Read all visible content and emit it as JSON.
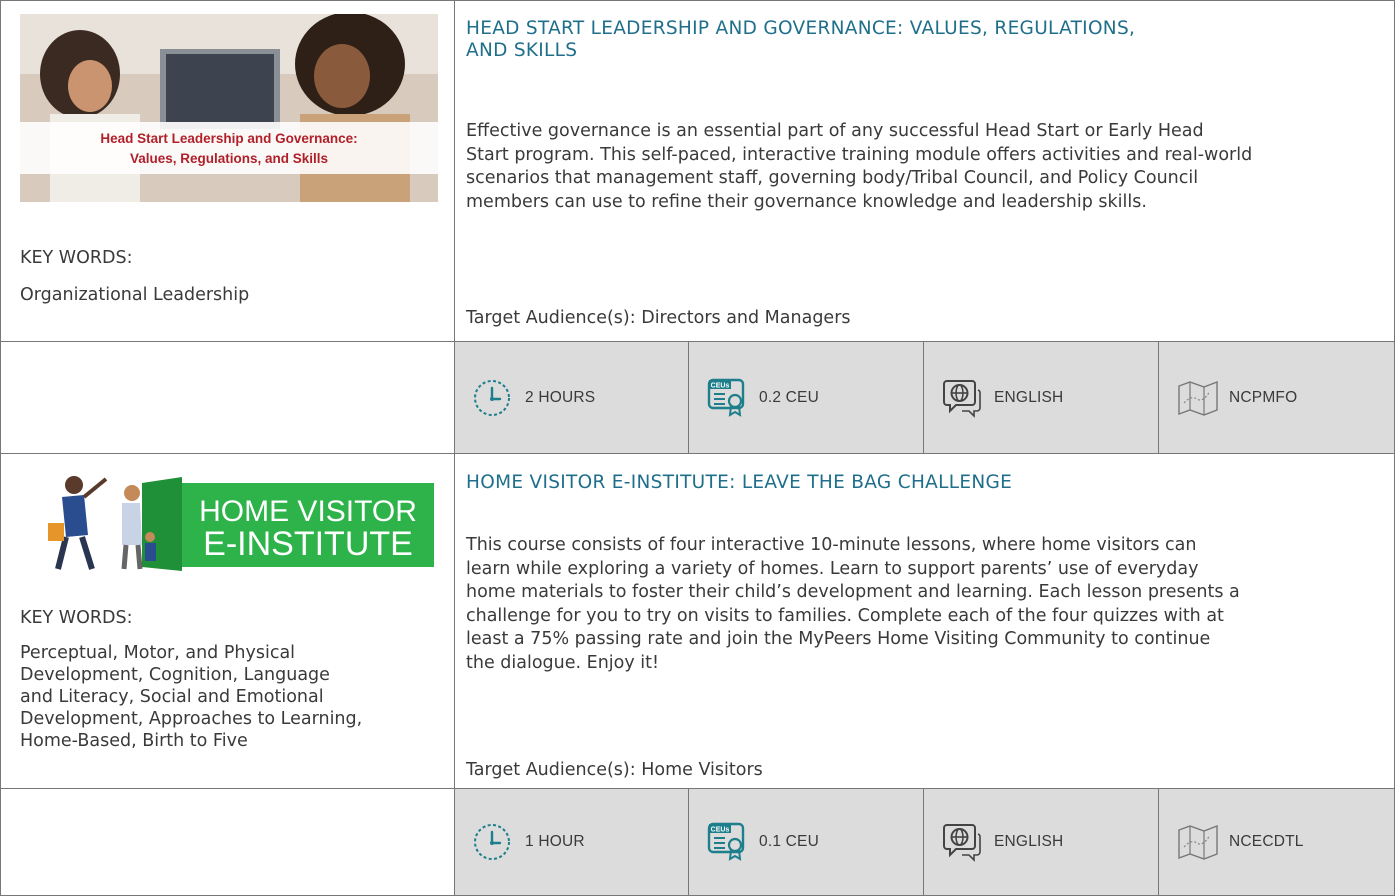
{
  "courses": [
    {
      "thumbnail_text": [
        "Head Start Leadership and Governance:",
        "Values, Regulations, and Skills"
      ],
      "title_lines": [
        "HEAD START LEADERSHIP AND GOVERNANCE: VALUES, REGULATIONS,",
        "AND SKILLS"
      ],
      "description_lines": [
        "Effective governance is an essential part of any successful Head Start or Early Head",
        "Start program. This self-paced, interactive training module offers activities and real-world",
        "scenarios that management staff, governing body/Tribal Council, and Policy Council",
        "members can use to refine their governance knowledge and leadership skills."
      ],
      "keywords_label": "KEY WORDS:",
      "keywords_lines": [
        "Organizational Leadership"
      ],
      "target_audience": "Target Audience(s): Directors and Managers",
      "duration": "2 HOURS",
      "ceu": "0.2 CEU",
      "language": "ENGLISH",
      "center": "NCPMFO"
    },
    {
      "thumbnail_text": [
        "HOME VISITOR",
        "E-INSTITUTE"
      ],
      "title_lines": [
        "HOME VISITOR E-INSTITUTE: LEAVE THE BAG CHALLENGE"
      ],
      "description_lines": [
        "This course consists of four interactive 10-minute lessons, where home visitors can",
        "learn while exploring a variety of homes. Learn to support parents’ use of everyday",
        "home materials to foster their child’s development and learning. Each lesson presents a",
        "challenge for you to try on visits to families. Complete each of the four quizzes with at",
        "least a 75% passing rate and join the MyPeers Home Visiting Community to continue",
        "the dialogue. Enjoy it!"
      ],
      "keywords_label": "KEY WORDS:",
      "keywords_lines": [
        "Perceptual, Motor, and Physical",
        "Development, Cognition, Language",
        "and Literacy, Social and Emotional",
        "Development, Approaches to Learning,",
        "Home-Based, Birth to Five"
      ],
      "target_audience": "Target Audience(s): Home Visitors",
      "duration": "1 HOUR",
      "ceu": "0.1 CEU",
      "language": "ENGLISH",
      "center": "NCECDTL"
    }
  ],
  "icons": {
    "clock": "clock-icon",
    "ceu": "ceu-certificate-icon",
    "language": "globe-speech-icon",
    "map": "map-icon",
    "ceu_badge_text": "CEUs"
  },
  "colors": {
    "title": "#1f6f8b",
    "icon_teal": "#1e7f8c",
    "meta_bg": "#dcdcdc",
    "border": "#777777",
    "einstitute_green": "#2db34a",
    "leadership_banner_text": "#b0202a"
  }
}
